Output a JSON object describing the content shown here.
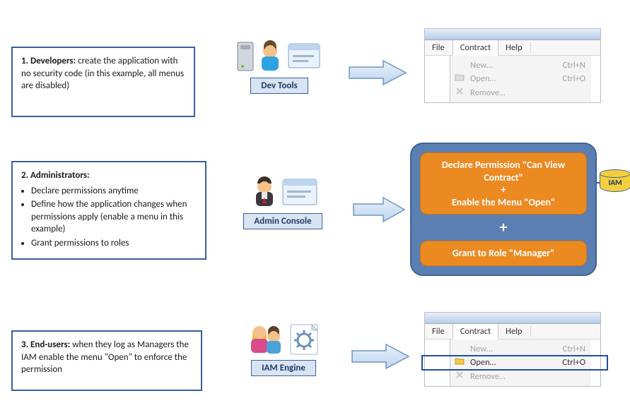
{
  "row1": {
    "textbox": {
      "boldLead": "1. Developers:",
      "rest": " create the application with no security code (in this example, all menus are disabled)"
    },
    "centerLabel": "Dev Tools",
    "menu": {
      "items": [
        "File",
        "Contract",
        "Help"
      ],
      "activeIndex": 1,
      "dropdown": [
        {
          "icon": "",
          "label": "New…",
          "shortcut": "Ctrl+N",
          "enabled": false
        },
        {
          "icon": "folder",
          "label": "Open…",
          "shortcut": "Ctrl+O",
          "enabled": false
        },
        {
          "icon": "x",
          "label": "Remove…",
          "shortcut": "",
          "enabled": false
        }
      ]
    }
  },
  "row2": {
    "textbox": {
      "boldLead": "2. Administrators:",
      "bullets": [
        "Declare permissions anytime",
        "Define how the application changes when permissions apply (enable a menu in this example)",
        "Grant permissions to roles"
      ]
    },
    "centerLabel": "Admin Console",
    "panel": {
      "declare": "Declare Permission \"Can View Contract\"\n+\nEnable the Menu \"Open\"",
      "grant": "Grant to Role \"Manager\""
    },
    "iamLabel": "IAM"
  },
  "row3": {
    "textbox": {
      "boldLead": "3. End-users:",
      "rest": " when they log as Managers the IAM enable the menu \"Open\" to enforce the permission"
    },
    "centerLabel": "IAM Engine",
    "menu": {
      "items": [
        "File",
        "Contract",
        "Help"
      ],
      "activeIndex": 1,
      "dropdown": [
        {
          "icon": "",
          "label": "New…",
          "shortcut": "Ctrl+N",
          "enabled": false
        },
        {
          "icon": "folder",
          "label": "Open…",
          "shortcut": "Ctrl+O",
          "enabled": true
        },
        {
          "icon": "x",
          "label": "Remove…",
          "shortcut": "",
          "enabled": false
        }
      ]
    }
  }
}
